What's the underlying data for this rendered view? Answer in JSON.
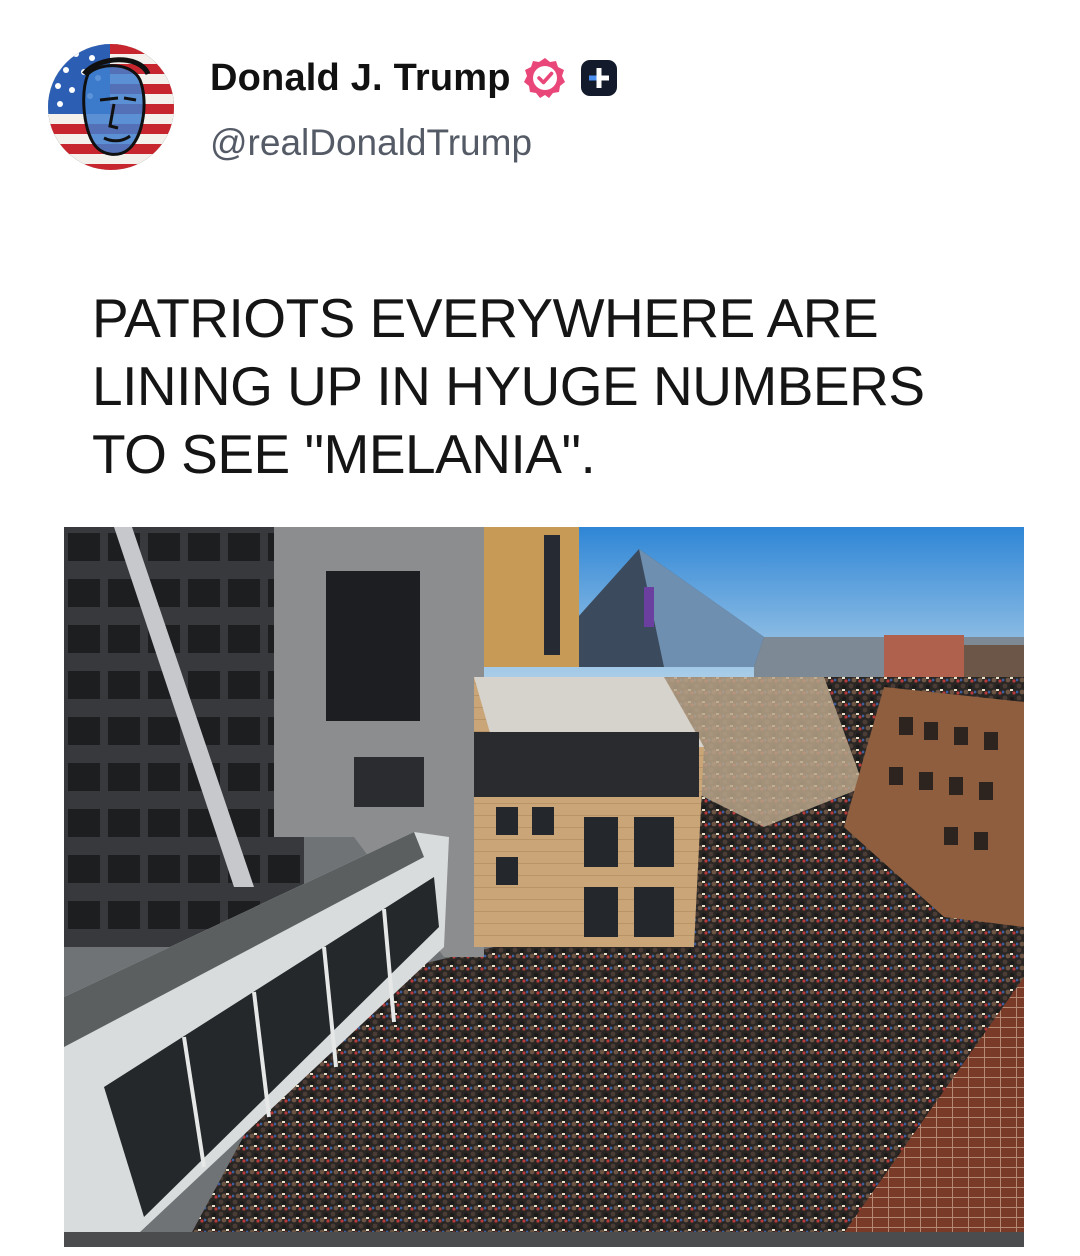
{
  "post": {
    "author": {
      "display_name": "Donald J. Trump",
      "handle": "@realDonaldTrump",
      "avatar_icon": "flag-portrait-avatar",
      "verified_icon": "verified-badge-icon",
      "plus_icon": "plus-badge-icon"
    },
    "text_lines": [
      "PATRIOTS EVERYWHERE ARE",
      "LINING UP IN HYUGE NUMBERS",
      "TO SEE \"MELANIA\"."
    ],
    "photo": {
      "subject": "aerial-crowd-photo"
    }
  },
  "colors": {
    "verified_badge": "#e9477a",
    "plus_badge": "#121a2b",
    "handle_text": "#555b66"
  }
}
